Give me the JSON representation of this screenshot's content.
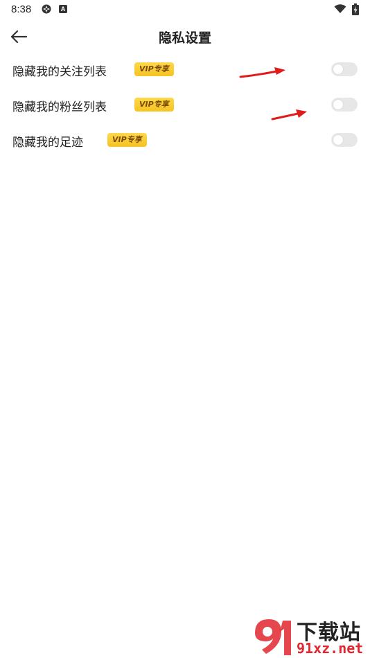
{
  "status_bar": {
    "time": "8:38",
    "system_icon": "gear-icon",
    "app_icon_letter": "A"
  },
  "header": {
    "title": "隐私设置",
    "back_icon": "arrow-left-icon"
  },
  "settings": [
    {
      "label": "隐藏我的关注列表",
      "badge": "VIP专享",
      "enabled": false
    },
    {
      "label": "隐藏我的粉丝列表",
      "badge": "VIP专享",
      "enabled": false
    },
    {
      "label": "隐藏我的足迹",
      "badge": "VIP专享",
      "enabled": false
    }
  ],
  "watermark": {
    "logo_text": "91",
    "text_top": "下载站",
    "text_bottom": "91xz.net"
  },
  "colors": {
    "badge": "#f5c423",
    "badge_text": "#7a4a00",
    "toggle_off": "#e7e7e7",
    "annotation_arrow": "#e01b1b",
    "watermark_red": "#e2262f"
  }
}
